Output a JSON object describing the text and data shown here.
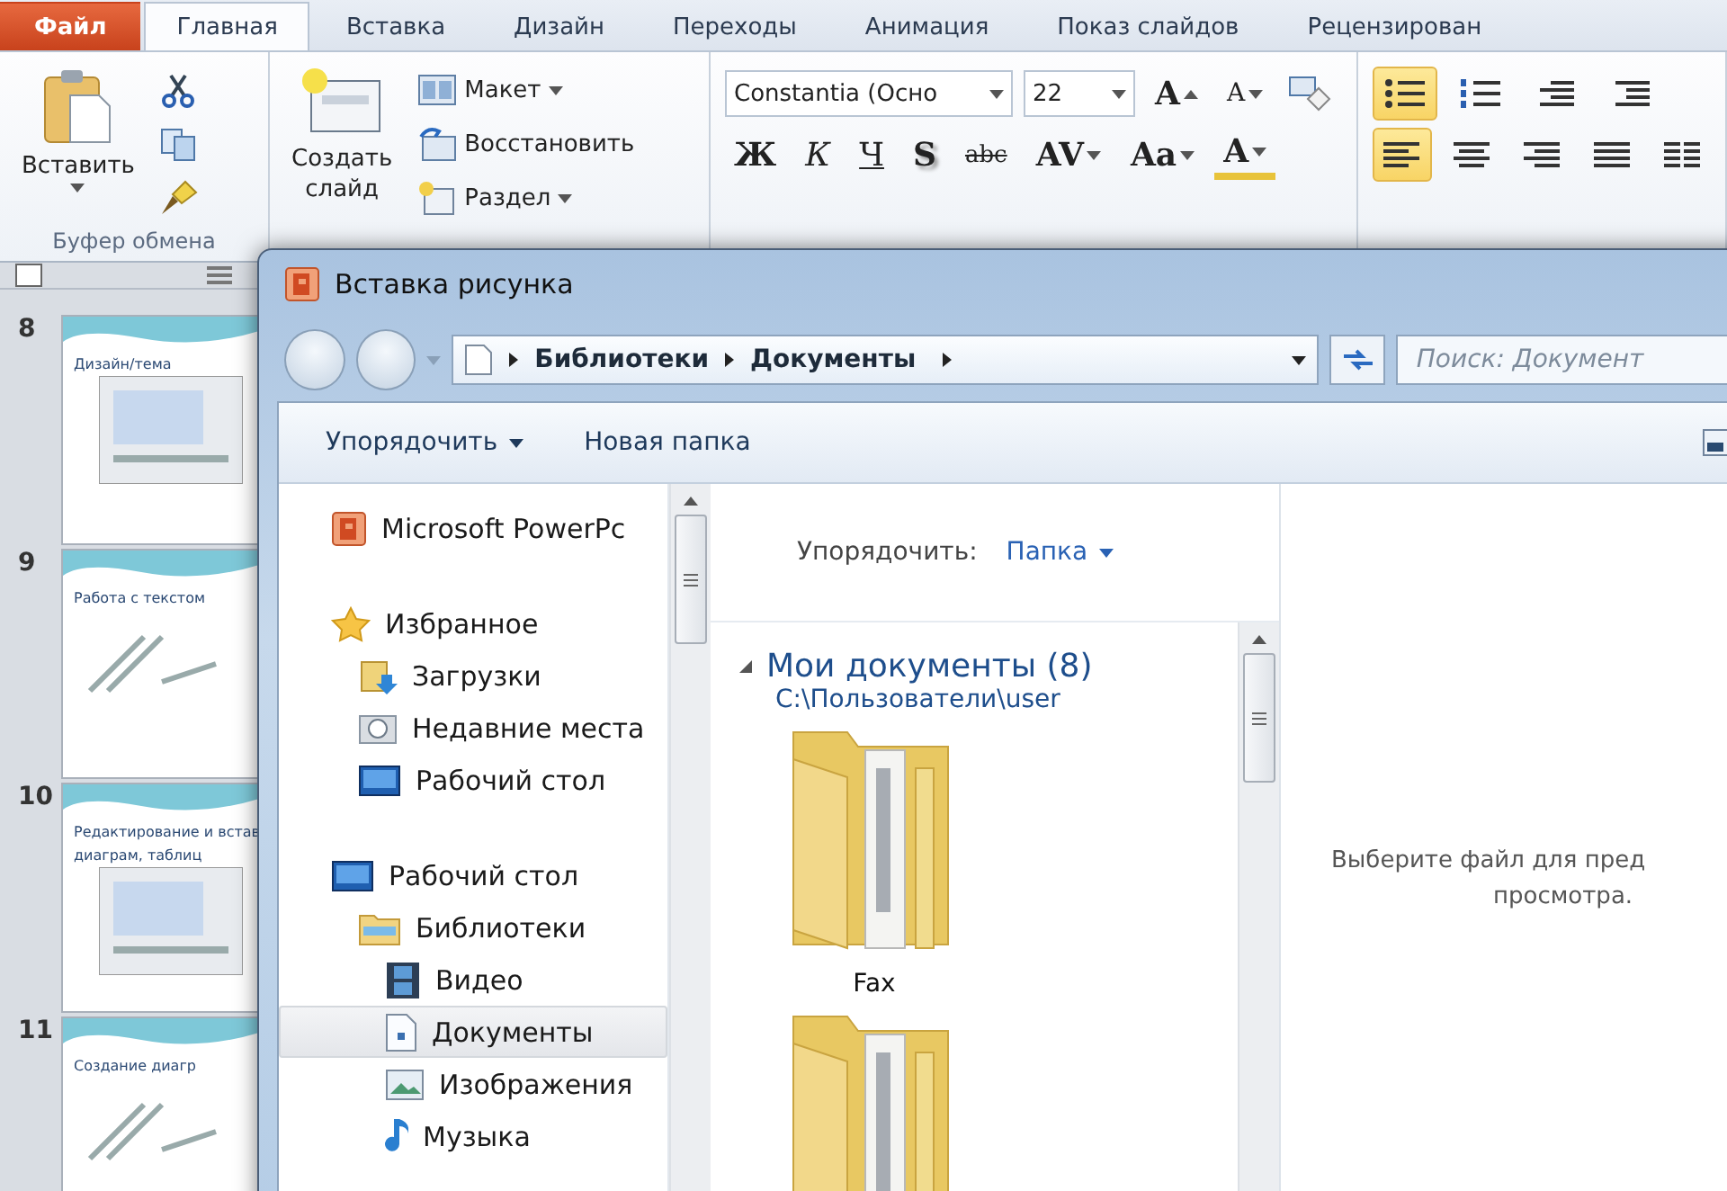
{
  "ribbon": {
    "tabs": [
      {
        "label": "Файл",
        "kind": "file",
        "selected": false
      },
      {
        "label": "Главная",
        "kind": "tab",
        "selected": true
      },
      {
        "label": "Вставка",
        "kind": "tab",
        "selected": false
      },
      {
        "label": "Дизайн",
        "kind": "tab",
        "selected": false
      },
      {
        "label": "Переходы",
        "kind": "tab",
        "selected": false
      },
      {
        "label": "Анимация",
        "kind": "tab",
        "selected": false
      },
      {
        "label": "Показ слайдов",
        "kind": "tab",
        "selected": false
      },
      {
        "label": "Рецензирован",
        "kind": "tab",
        "selected": false
      }
    ],
    "clipboard": {
      "paste": "Вставить",
      "group_label": "Буфер обмена"
    },
    "slides_group": {
      "new_slide": [
        "Создать",
        "слайд"
      ],
      "commands": [
        {
          "label": "Макет",
          "kind": "layout",
          "dropdown": true
        },
        {
          "label": "Восстановить",
          "kind": "reset",
          "dropdown": false
        },
        {
          "label": "Раздел",
          "kind": "section",
          "dropdown": true
        }
      ]
    },
    "font": {
      "name": "Constantia (Осно",
      "size": "22",
      "size_buttons": [
        {
          "label": "A",
          "kind": "grow"
        },
        {
          "label": "A",
          "kind": "shrink"
        }
      ],
      "buttons": [
        {
          "label": "Ж",
          "kind": "bold"
        },
        {
          "label": "К",
          "kind": "italic"
        },
        {
          "label": "Ч",
          "kind": "underline"
        },
        {
          "label": "S",
          "kind": "shadow"
        },
        {
          "label": "abc",
          "kind": "strike"
        },
        {
          "label": "AV",
          "kind": "spacing"
        },
        {
          "label": "Aa",
          "kind": "case"
        },
        {
          "label": "A",
          "kind": "color"
        }
      ]
    },
    "paragraph": {
      "rows": [
        [
          {
            "kind": "bullets",
            "selected": true
          },
          {
            "kind": "numbering",
            "selected": false
          },
          {
            "kind": "outdent",
            "selected": false
          },
          {
            "kind": "indent",
            "selected": false
          }
        ],
        [
          {
            "kind": "align-left",
            "selected": true
          },
          {
            "kind": "align-center",
            "selected": false
          },
          {
            "kind": "align-right",
            "selected": false
          },
          {
            "kind": "justify",
            "selected": false
          },
          {
            "kind": "columns",
            "selected": false
          }
        ]
      ]
    }
  },
  "slides": [
    {
      "number": "8",
      "title": "Дизайн/тема",
      "kind": "screenshot"
    },
    {
      "number": "9",
      "title": "Работа с текстом",
      "kind": "text"
    },
    {
      "number": "10",
      "title": "Редактирование и встав",
      "subtitle": "диаграм, таблиц",
      "kind": "screenshot"
    },
    {
      "number": "11",
      "title": "Создание диагр",
      "kind": "text"
    }
  ],
  "dialog": {
    "title": "Вставка рисунка",
    "breadcrumb": [
      "Библиотеки",
      "Документы"
    ],
    "search_placeholder": "Поиск: Документ",
    "toolbar": [
      {
        "label": "Упорядочить",
        "dropdown": true
      },
      {
        "label": "Новая папка",
        "dropdown": false
      }
    ],
    "nav": [
      {
        "label": "Microsoft PowerPc",
        "kind": "app",
        "selected": false
      },
      {
        "label": "Избранное",
        "kind": "favorites",
        "selected": false,
        "children": [
          {
            "label": "Загрузки",
            "kind": "downloads",
            "selected": false
          },
          {
            "label": "Недавние места",
            "kind": "recent",
            "selected": false
          },
          {
            "label": "Рабочий стол",
            "kind": "desktop",
            "selected": false
          }
        ]
      },
      {
        "label": "Рабочий стол",
        "kind": "desktop",
        "selected": false,
        "children": [
          {
            "label": "Библиотеки",
            "kind": "libraries",
            "selected": false,
            "children": [
              {
                "label": "Видео",
                "kind": "video",
                "selected": false
              },
              {
                "label": "Документы",
                "kind": "documents",
                "selected": true
              },
              {
                "label": "Изображения",
                "kind": "pictures",
                "selected": false
              },
              {
                "label": "Музыка",
                "kind": "music",
                "selected": false
              }
            ]
          }
        ]
      }
    ],
    "content": {
      "arrange_label": "Упорядочить:",
      "arrange_value": "Папка",
      "library_title": "Мои документы (8)",
      "library_path": "C:\\Пользователи\\user",
      "items": [
        {
          "kind": "folder",
          "name": "Fax"
        },
        {
          "kind": "folder"
        }
      ]
    },
    "preview_lines": [
      "Выберите файл для пред",
      "просмотра."
    ]
  }
}
